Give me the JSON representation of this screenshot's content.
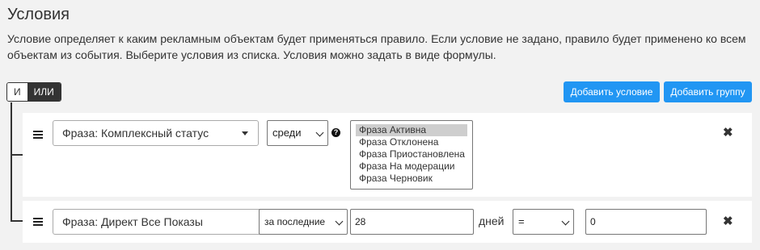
{
  "header": {
    "title": "Условия",
    "description": "Условие определяет к каким рекламным объектам будет применяться правило. Если условие не задано, правило будет применено ко всем объектам из события. Выберите условия из списка. Условия можно задать в виде формулы."
  },
  "logic": {
    "and_label": "И",
    "or_label": "ИЛИ",
    "selected": "ИЛИ"
  },
  "toolbar": {
    "add_condition_label": "Добавить условие",
    "add_group_label": "Добавить группу",
    "button_color": "#2196f3"
  },
  "conditions": [
    {
      "field": "Фраза: Комплексный статус",
      "operator": "среди",
      "help_icon": "question-circle-icon",
      "options": [
        "Фраза Активна",
        "Фраза Отклонена",
        "Фраза Приостановлена",
        "Фраза На модерации",
        "Фраза Черновик"
      ],
      "selected_option": "Фраза Активна",
      "remove_icon": "close-icon"
    },
    {
      "field": "Фраза: Директ Все Показы",
      "period": "за последние",
      "period_value": "28",
      "period_unit": "дней",
      "comparison": "=",
      "value": "0",
      "remove_icon": "close-icon"
    }
  ]
}
